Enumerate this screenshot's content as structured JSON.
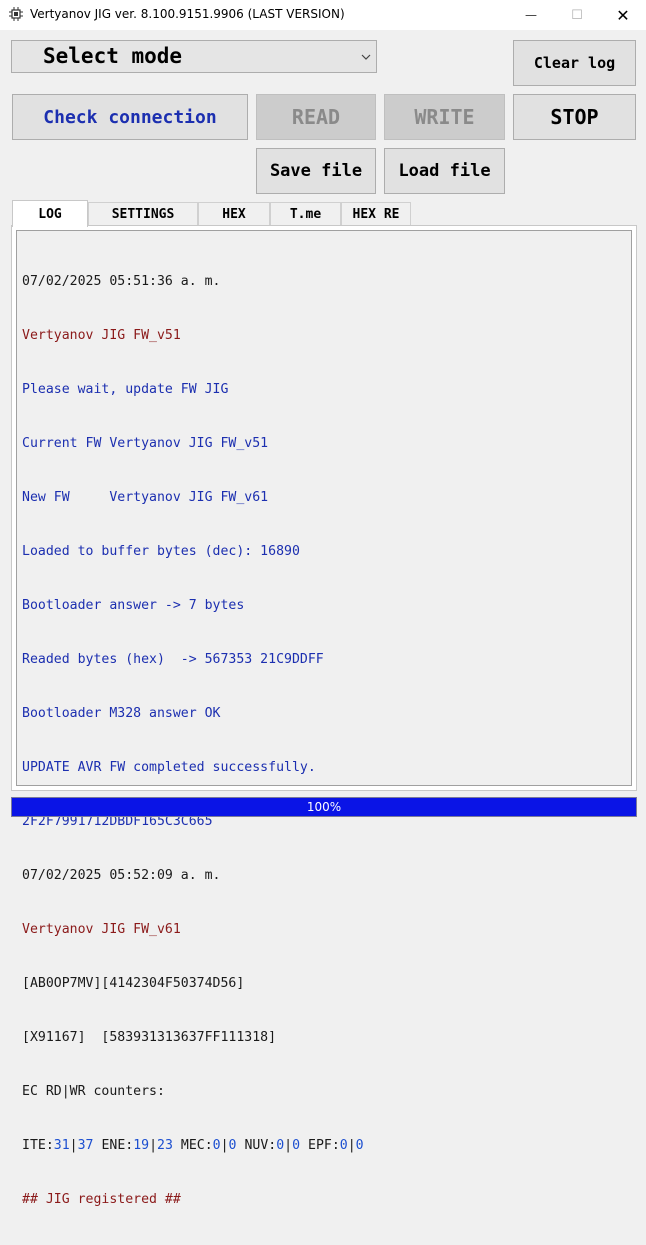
{
  "window": {
    "title": "Vertyanov JIG ver. 8.100.9151.9906 (LAST VERSION)",
    "minimize_glyph": "—",
    "maximize_glyph": "☐",
    "close_glyph": "✕"
  },
  "toolbar": {
    "mode_select": "Select mode",
    "clear_log": "Clear log",
    "check_connection": "Check connection",
    "read": "READ",
    "write": "WRITE",
    "stop": "STOP",
    "save_file": "Save file",
    "load_file": "Load file"
  },
  "tabs": [
    {
      "label": "LOG",
      "active": true
    },
    {
      "label": "SETTINGS",
      "active": false
    },
    {
      "label": "HEX",
      "active": false
    },
    {
      "label": "T.me",
      "active": false
    },
    {
      "label": "HEX RE",
      "active": false
    }
  ],
  "log": {
    "lines": [
      {
        "text": "07/02/2025 05:51:36 a. m.",
        "color": "black"
      },
      {
        "text": "Vertyanov JIG FW_v51",
        "color": "red"
      },
      {
        "text": "Please wait, update FW JIG",
        "color": "blue"
      },
      {
        "text": "Current FW Vertyanov JIG FW_v51",
        "color": "blue"
      },
      {
        "text": "New FW     Vertyanov JIG FW_v61",
        "color": "blue"
      },
      {
        "text": "Loaded to buffer bytes (dec): 16890",
        "color": "blue"
      },
      {
        "text": "Bootloader answer -> 7 bytes",
        "color": "blue"
      },
      {
        "text": "Readed bytes (hex)  -> 567353 21C9DDFF",
        "color": "blue"
      },
      {
        "text": "Bootloader M328 answer OK",
        "color": "blue"
      },
      {
        "text": "UPDATE AVR FW completed successfully.",
        "color": "blue"
      },
      {
        "text": "2F2F7991712DBDF165C3C665",
        "color": "blue"
      },
      {
        "text": "07/02/2025 05:52:09 a. m.",
        "color": "black"
      },
      {
        "text": "Vertyanov JIG FW_v61",
        "color": "red"
      },
      {
        "text": "[AB0OP7MV][4142304F50374D56]",
        "color": "black"
      },
      {
        "text": "[X91167]  [583931313637FF111318]",
        "color": "black"
      },
      {
        "text": "EC RD|WR counters:",
        "color": "black"
      }
    ],
    "counters": {
      "ite_label": "ITE:",
      "ite_rd": "31",
      "ite_wr": "37",
      "ene_label": " ENE:",
      "ene_rd": "19",
      "ene_wr": "23",
      "mec_label": " MEC:",
      "mec_rd": "0",
      "mec_wr": "0",
      "nuv_label": " NUV:",
      "nuv_rd": "0",
      "nuv_wr": "0",
      "epf_label": " EPF:",
      "epf_rd": "0",
      "epf_wr": "0",
      "sep": "|"
    },
    "final_line": "## JIG registered ##"
  },
  "progress": {
    "text": "100%",
    "value": 1.0
  },
  "colors": {
    "log_black": "#1a1a1a",
    "log_red": "#8b1a1a",
    "log_blue": "#1c2fb0",
    "progress_fill": "#0a14e6",
    "check_connection_text": "#1c2fb0"
  }
}
